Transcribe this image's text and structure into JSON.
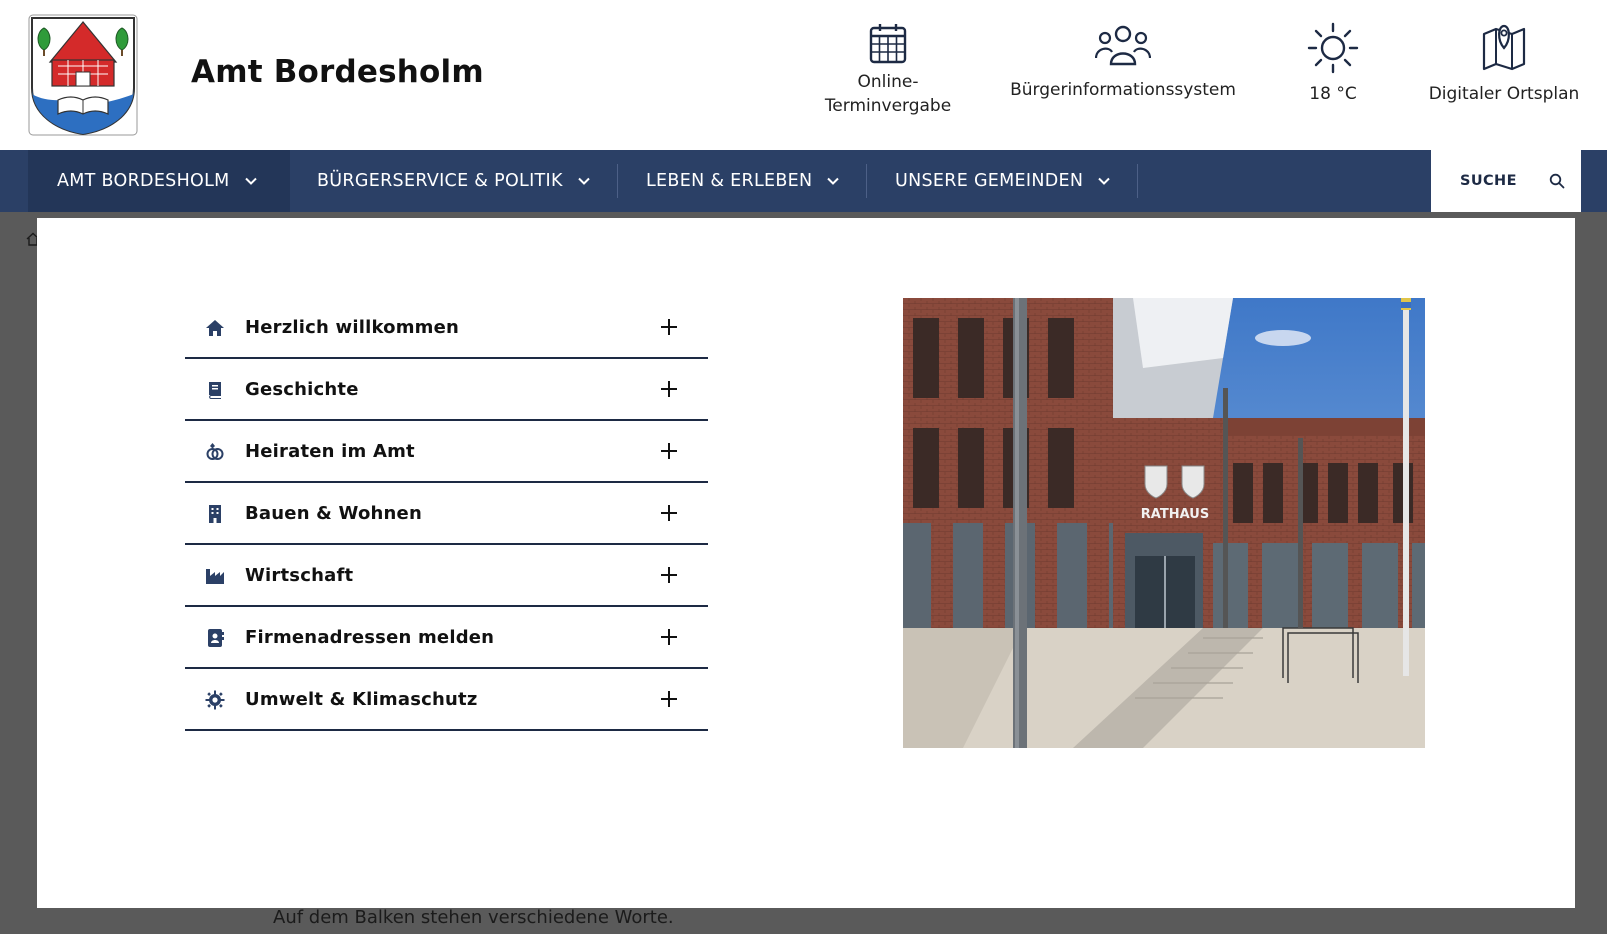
{
  "header": {
    "site_title": "Amt Bordesholm",
    "logo_icon": "coat-of-arms-icon",
    "quick_links": [
      {
        "label_line1": "Online-",
        "label_line2": "Terminvergabe",
        "icon": "calendar-icon"
      },
      {
        "label": "Bürgerinformationssystem",
        "icon": "people-group-icon"
      },
      {
        "label": "18 °C",
        "icon": "sun-icon"
      },
      {
        "label": "Digitaler Ortsplan",
        "icon": "map-pin-icon"
      }
    ]
  },
  "nav": {
    "items": [
      {
        "label": "AMT BORDESHOLM",
        "active": true
      },
      {
        "label": "BÜRGERSERVICE & POLITIK"
      },
      {
        "label": "LEBEN & ERLEBEN"
      },
      {
        "label": "UNSERE GEMEINDEN"
      }
    ],
    "search_label": "SUCHE"
  },
  "mega_menu": {
    "items": [
      {
        "label": "Herzlich willkommen",
        "icon": "home-icon"
      },
      {
        "label": "Geschichte",
        "icon": "book-icon"
      },
      {
        "label": "Heiraten im Amt",
        "icon": "rings-icon"
      },
      {
        "label": "Bauen & Wohnen",
        "icon": "building-icon"
      },
      {
        "label": "Wirtschaft",
        "icon": "industry-icon"
      },
      {
        "label": "Firmenadressen melden",
        "icon": "address-book-icon"
      },
      {
        "label": "Umwelt & Klimaschutz",
        "icon": "gear-sun-icon"
      }
    ],
    "photo_sign_text": "RATHAUS"
  },
  "behind": {
    "text": "Auf dem Balken stehen verschiedene Worte."
  },
  "colors": {
    "nav_bg": "#2b4066",
    "nav_active": "#233658",
    "icon_dark": "#1d2a44",
    "overlay": "#5a5a5a"
  }
}
